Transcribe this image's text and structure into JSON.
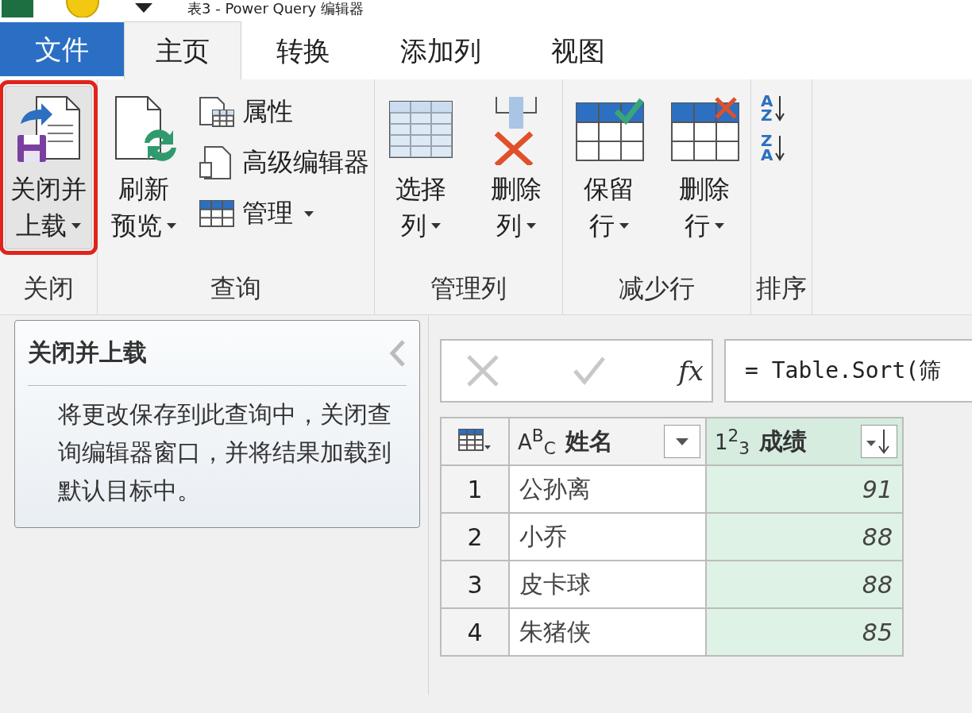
{
  "window": {
    "title": "表3 - Power Query 编辑器"
  },
  "tabs": [
    {
      "label": "文件",
      "kind": "file",
      "selected": false
    },
    {
      "label": "主页",
      "kind": "tab",
      "selected": true
    },
    {
      "label": "转换",
      "kind": "tab",
      "selected": false
    },
    {
      "label": "添加列",
      "kind": "tab",
      "selected": false
    },
    {
      "label": "视图",
      "kind": "tab",
      "selected": false
    }
  ],
  "ribbon": {
    "groups": [
      {
        "label": "关闭",
        "items": [
          {
            "kind": "large",
            "lines": [
              "关闭并",
              "上载"
            ],
            "dropdown": true,
            "highlighted": true
          }
        ]
      },
      {
        "label": "查询",
        "items": [
          {
            "kind": "large",
            "lines": [
              "刷新",
              "预览"
            ],
            "dropdown": true,
            "highlighted": false
          },
          {
            "kind": "stack",
            "items": [
              {
                "label": "属性",
                "dropdown": false
              },
              {
                "label": "高级编辑器",
                "dropdown": false
              },
              {
                "label": "管理",
                "dropdown": true
              }
            ]
          }
        ]
      },
      {
        "label": "管理列",
        "items": [
          {
            "kind": "large",
            "lines": [
              "选择",
              "列"
            ],
            "dropdown": true,
            "highlighted": false
          },
          {
            "kind": "large",
            "lines": [
              "删除",
              "列"
            ],
            "dropdown": true,
            "highlighted": false
          }
        ]
      },
      {
        "label": "减少行",
        "items": [
          {
            "kind": "large",
            "lines": [
              "保留",
              "行"
            ],
            "dropdown": true,
            "highlighted": false
          },
          {
            "kind": "large",
            "lines": [
              "删除",
              "行"
            ],
            "dropdown": true,
            "highlighted": false
          }
        ]
      },
      {
        "label": "排序",
        "items": [
          {
            "kind": "sort",
            "buttons": [
              {
                "top": "A",
                "bottom": "Z"
              },
              {
                "top": "Z",
                "bottom": "A"
              }
            ]
          }
        ]
      }
    ]
  },
  "tooltip": {
    "title": "关闭并上载",
    "text": "将更改保存到此查询中，关闭查询编辑器窗口，并将结果加载到默认目标中。"
  },
  "formula_bar": {
    "fx": "fx",
    "formula": "= Table.Sort(筛"
  },
  "table": {
    "columns": [
      {
        "type": "A$^{B}$$_{C}$",
        "name": "姓名",
        "sorted": false,
        "selected": false
      },
      {
        "type": "1$^{2}$$_{3}$",
        "name": "成绩",
        "sorted": true,
        "selected": true
      }
    ],
    "rows": [
      {
        "index": "1",
        "cells": [
          "公孙离",
          "91"
        ]
      },
      {
        "index": "2",
        "cells": [
          "小乔",
          "88"
        ]
      },
      {
        "index": "3",
        "cells": [
          "皮卡球",
          "88"
        ]
      },
      {
        "index": "4",
        "cells": [
          "朱猪侠",
          "85"
        ]
      }
    ]
  }
}
